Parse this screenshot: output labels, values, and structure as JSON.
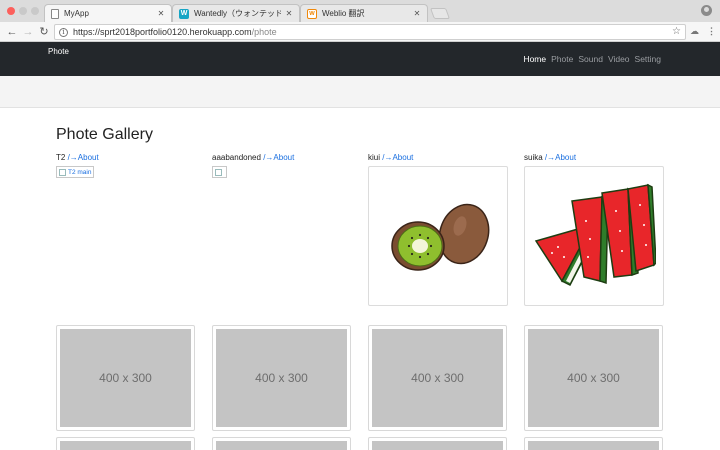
{
  "browser": {
    "tabs": [
      {
        "title": "MyApp",
        "favicon": "page-icon",
        "active": true
      },
      {
        "title": "Wantedly（ウォンテッドリー）- ...",
        "favicon": "W",
        "favicon_color": "#16a5c5"
      },
      {
        "title": "Weblio 翻訳",
        "favicon": "w",
        "favicon_color": "#f0880a"
      }
    ],
    "url_host": "https://sprt2018portfolio0120.herokuapp.com",
    "url_path": "/phote"
  },
  "navbar": {
    "brand": "Phote",
    "links": [
      {
        "label": "Home",
        "active": true
      },
      {
        "label": "Phote"
      },
      {
        "label": "Sound"
      },
      {
        "label": "Video"
      },
      {
        "label": "Setting"
      }
    ]
  },
  "gallery": {
    "title": "Phote Gallery",
    "items": [
      {
        "name": "T2",
        "link": "/→About",
        "image": "broken",
        "alt": "T2 main"
      },
      {
        "name": "aaabandoned",
        "link": "/→About",
        "image": "broken",
        "alt": ""
      },
      {
        "name": "kiui",
        "link": "/→About",
        "image": "kiwi"
      },
      {
        "name": "suika",
        "link": "/→About",
        "image": "watermelon"
      }
    ],
    "placeholder_label": "400 x 300"
  }
}
